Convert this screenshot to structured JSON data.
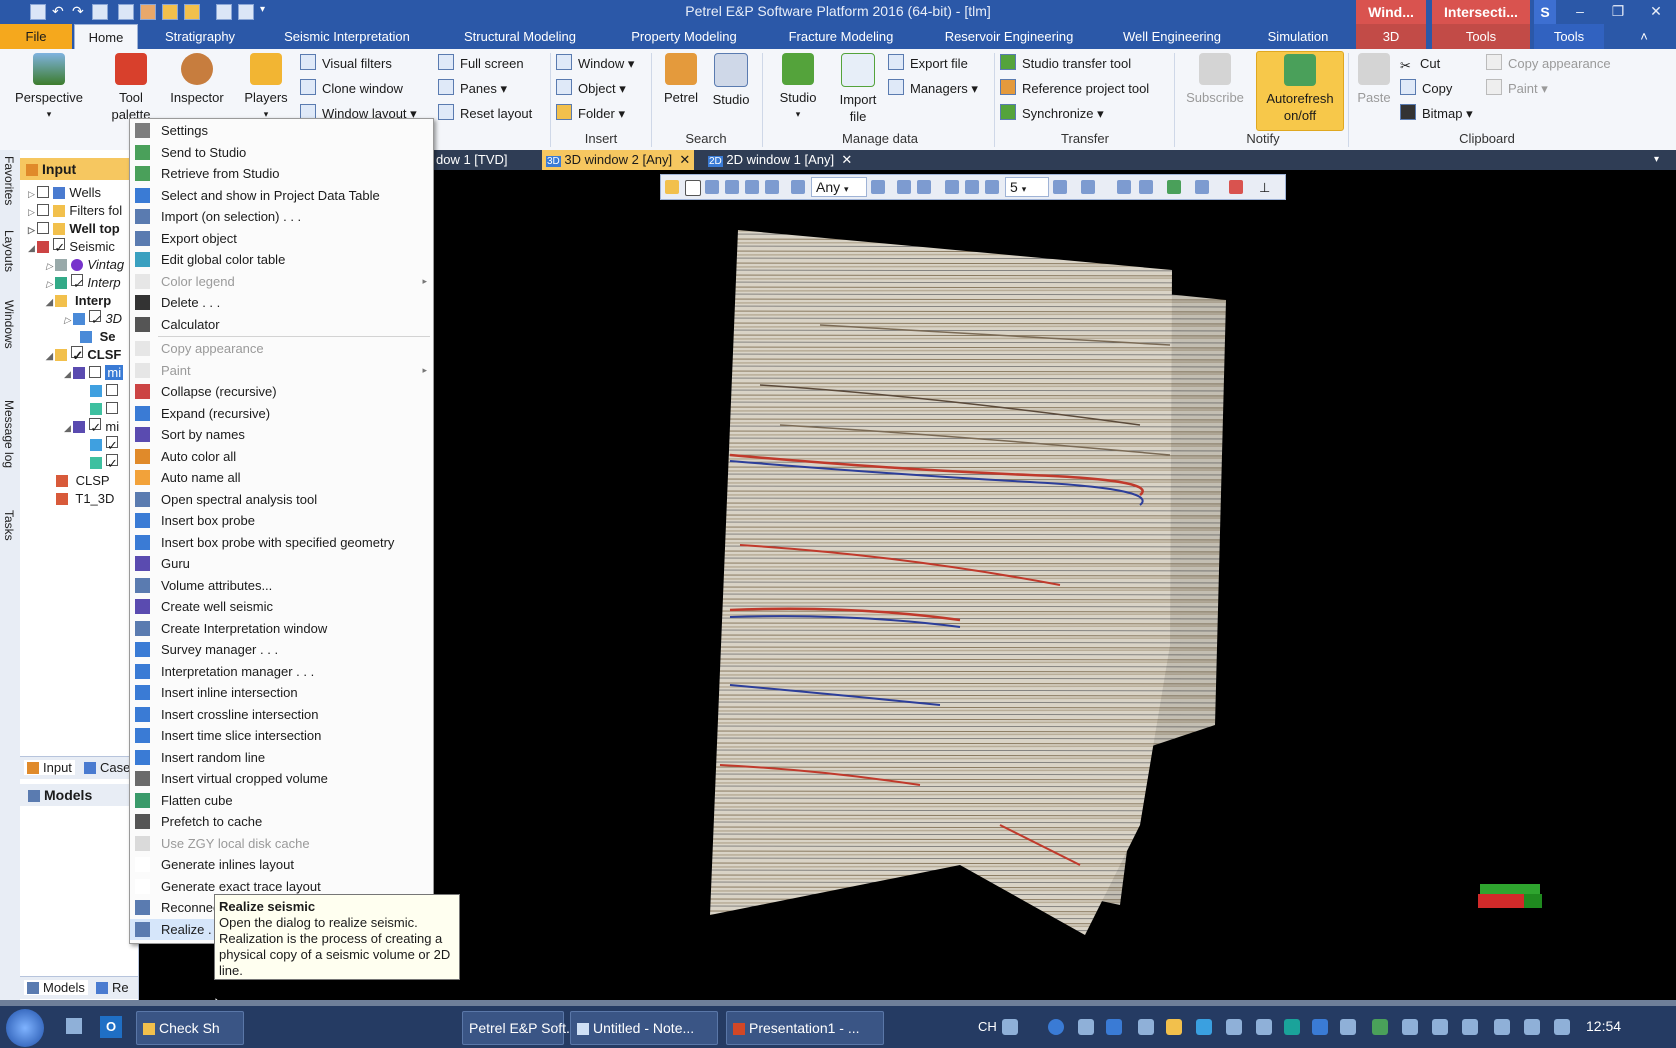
{
  "window": {
    "title": "Petrel E&P Software Platform 2016 (64-bit) - [tlm]",
    "context_tabs": [
      "Wind...",
      "Intersecti...",
      "S"
    ],
    "context_colors": [
      "#d9534f",
      "#d9534f",
      "#3d6fd1"
    ]
  },
  "ribbon_tabs": [
    {
      "label": "File",
      "state": "file"
    },
    {
      "label": "Home",
      "state": "active"
    },
    {
      "label": "Stratigraphy"
    },
    {
      "label": "Seismic Interpretation"
    },
    {
      "label": "Structural Modeling"
    },
    {
      "label": "Property Modeling"
    },
    {
      "label": "Fracture Modeling"
    },
    {
      "label": "Reservoir Engineering"
    },
    {
      "label": "Well Engineering"
    },
    {
      "label": "Simulation"
    },
    {
      "label": "3D"
    },
    {
      "label": "Tools"
    },
    {
      "label": "Tools"
    }
  ],
  "ribbon": {
    "perspective": "Perspective",
    "tool_palette": "Tool palette",
    "inspector": "Inspector",
    "players": "Players",
    "visual_filters": "Visual filters",
    "clone_window": "Clone window",
    "window_layout": "Window layout",
    "full_screen": "Full screen",
    "panes": "Panes",
    "reset_layout": "Reset layout",
    "window": "Window",
    "object": "Object",
    "folder": "Folder",
    "insert_label": "Insert",
    "petrel": "Petrel",
    "studio": "Studio",
    "search_label": "Search",
    "studio2": "Studio",
    "import_file": "Import file",
    "export_file": "Export file",
    "managers": "Managers",
    "manage_data_label": "Manage data",
    "studio_transfer_tool": "Studio transfer tool",
    "reference_project_tool": "Reference project tool",
    "synchronize": "Synchronize",
    "transfer_label": "Transfer",
    "subscribe": "Subscribe",
    "autorefresh": "Autorefresh on/off",
    "notify_label": "Notify",
    "paste": "Paste",
    "cut": "Cut",
    "copy": "Copy",
    "bitmap": "Bitmap",
    "copy_appearance": "Copy appearance",
    "paint": "Paint",
    "clipboard_label": "Clipboard"
  },
  "left_strip": [
    "Favorites",
    "Layouts",
    "Windows",
    "Message log",
    "Tasks"
  ],
  "input_panel": {
    "title": "Input",
    "tree": [
      {
        "label": "Wells",
        "bold": false
      },
      {
        "label": "Filters fol",
        "bold": false
      },
      {
        "label": "Well top",
        "bold": true
      },
      {
        "label": "Seismic",
        "bold": false
      },
      {
        "label": "Vintag",
        "italic": true
      },
      {
        "label": "Interp",
        "italic": true
      },
      {
        "label": "Interp",
        "bold": true
      },
      {
        "label": "3D",
        "italic": true
      },
      {
        "label": "Se",
        "bold": true
      },
      {
        "label": "CLSF",
        "bold": true
      },
      {
        "label": "mi",
        "bold": false
      },
      {
        "label": "",
        "bold": false
      },
      {
        "label": "",
        "bold": false
      },
      {
        "label": "mi",
        "bold": false
      },
      {
        "label": "",
        "bold": false
      },
      {
        "label": "",
        "bold": false
      },
      {
        "label": "CLSP",
        "bold": false
      },
      {
        "label": "T1_3D",
        "bold": false
      }
    ],
    "bottom_tabs": [
      "Input",
      "Case"
    ],
    "models_title": "Models",
    "models_tabs": [
      "Models",
      "Re"
    ]
  },
  "doc_tabs": [
    {
      "label": "dow 1 [TVD]",
      "active": false
    },
    {
      "label": "3D window 2 [Any]",
      "active": true
    },
    {
      "label": "2D window 1 [Any]",
      "active": false
    }
  ],
  "view_toolbar": {
    "domain": "Any",
    "value": "5"
  },
  "context_menu": [
    {
      "label": "Settings",
      "disabled": false
    },
    {
      "label": "Send to Studio",
      "disabled": false
    },
    {
      "label": "Retrieve from Studio",
      "disabled": false
    },
    {
      "label": "Select and show in Project Data Table",
      "disabled": false
    },
    {
      "label": "Import (on selection) . . .",
      "disabled": false
    },
    {
      "label": "Export object",
      "disabled": false
    },
    {
      "label": "Edit global color table",
      "disabled": false
    },
    {
      "label": "Color legend",
      "disabled": true,
      "submenu": true
    },
    {
      "label": "Delete . . .",
      "disabled": false
    },
    {
      "label": "Calculator",
      "disabled": false,
      "sep_after": true
    },
    {
      "label": "Copy appearance",
      "disabled": true
    },
    {
      "label": "Paint",
      "disabled": true,
      "submenu": true
    },
    {
      "label": "Collapse (recursive)",
      "disabled": false
    },
    {
      "label": "Expand (recursive)",
      "disabled": false
    },
    {
      "label": "Sort by names",
      "disabled": false
    },
    {
      "label": "Auto color all",
      "disabled": false
    },
    {
      "label": "Auto name all",
      "disabled": false
    },
    {
      "label": "Open spectral analysis tool",
      "disabled": false
    },
    {
      "label": "Insert box probe",
      "disabled": false
    },
    {
      "label": "Insert box probe with specified geometry",
      "disabled": false
    },
    {
      "label": "Guru",
      "disabled": false
    },
    {
      "label": "Volume attributes...",
      "disabled": false
    },
    {
      "label": "Create well seismic",
      "disabled": false
    },
    {
      "label": "Create Interpretation window",
      "disabled": false
    },
    {
      "label": "Survey manager . . .",
      "disabled": false
    },
    {
      "label": "Interpretation manager . . .",
      "disabled": false
    },
    {
      "label": "Insert inline intersection",
      "disabled": false
    },
    {
      "label": "Insert crossline intersection",
      "disabled": false
    },
    {
      "label": "Insert time slice intersection",
      "disabled": false
    },
    {
      "label": "Insert random line",
      "disabled": false
    },
    {
      "label": "Insert virtual cropped volume",
      "disabled": false
    },
    {
      "label": "Flatten cube",
      "disabled": false
    },
    {
      "label": "Prefetch to cache",
      "disabled": false
    },
    {
      "label": "Use ZGY local disk cache",
      "disabled": true
    },
    {
      "label": "Generate inlines layout",
      "disabled": false
    },
    {
      "label": "Generate exact trace layout",
      "disabled": false
    },
    {
      "label": "Reconnect",
      "disabled": false
    },
    {
      "label": "Realize . . .",
      "disabled": false,
      "highlight": true
    }
  ],
  "tooltip": {
    "title": "Realize seismic",
    "body": "Open the dialog to realize seismic. Realization is the process of creating a physical copy of a seismic volume or 2D line."
  },
  "taskbar": {
    "items": [
      "Check Sh",
      "Petrel E&P Soft...",
      "Untitled - Note...",
      "Presentation1 - ..."
    ],
    "lang": "CH",
    "clock": "12:54"
  }
}
